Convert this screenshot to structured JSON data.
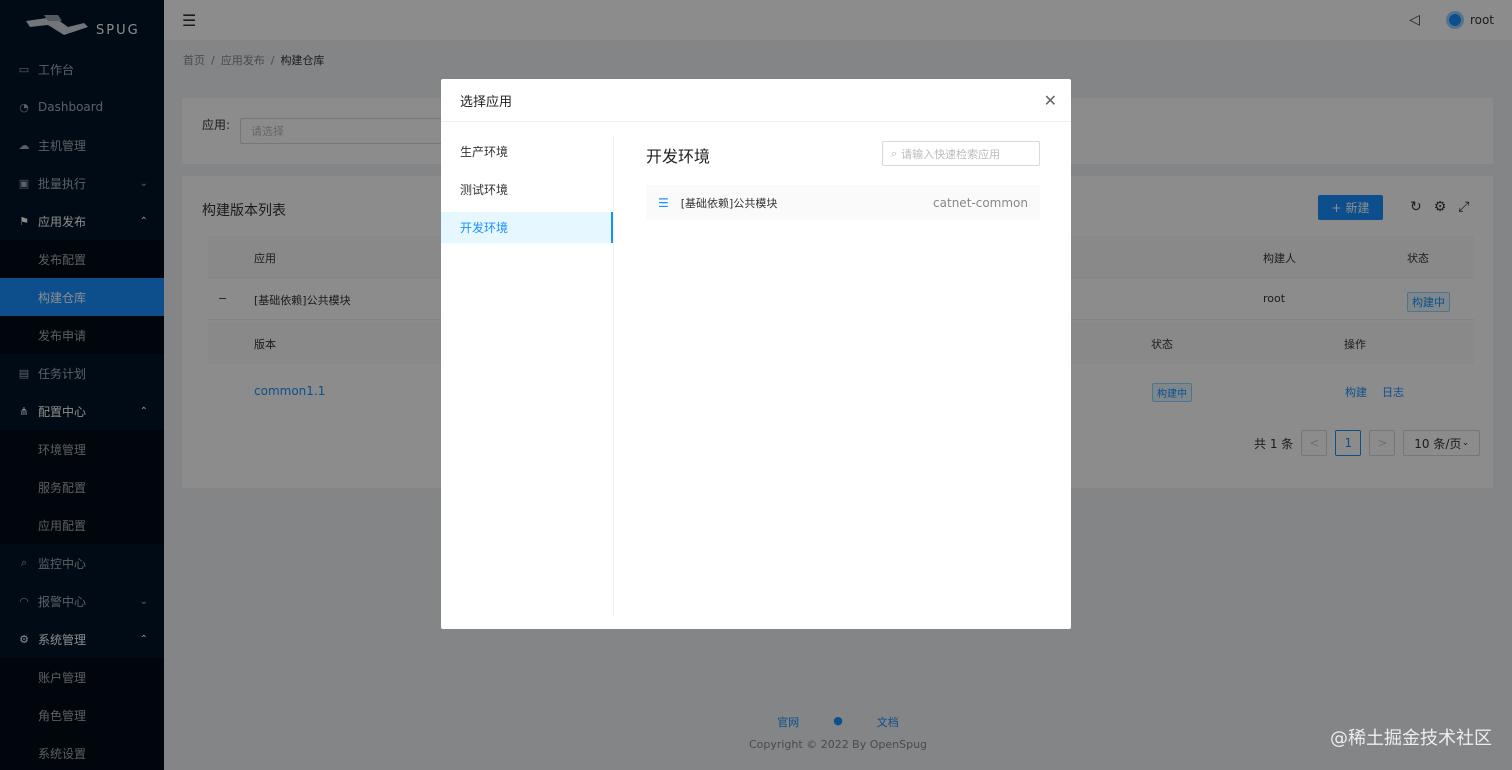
{
  "sidebar": {
    "logo_text": "SPUG",
    "items": [
      {
        "label": "工作台",
        "icon": "monitor-icon"
      },
      {
        "label": "Dashboard",
        "icon": "dashboard-icon"
      },
      {
        "label": "主机管理",
        "icon": "cloud-server-icon"
      },
      {
        "label": "批量执行",
        "icon": "code-icon"
      },
      {
        "label": "应用发布",
        "icon": "flag-icon"
      },
      {
        "label": "发布配置"
      },
      {
        "label": "构建仓库"
      },
      {
        "label": "发布申请"
      },
      {
        "label": "任务计划",
        "icon": "schedule-icon"
      },
      {
        "label": "配置中心",
        "icon": "deployment-icon"
      },
      {
        "label": "环境管理"
      },
      {
        "label": "服务配置"
      },
      {
        "label": "应用配置"
      },
      {
        "label": "监控中心",
        "icon": "search-icon"
      },
      {
        "label": "报警中心",
        "icon": "alert-icon"
      },
      {
        "label": "系统管理",
        "icon": "setting-icon"
      },
      {
        "label": "账户管理"
      },
      {
        "label": "角色管理"
      },
      {
        "label": "系统设置"
      }
    ]
  },
  "header": {
    "user": "root"
  },
  "breadcrumb": [
    "首页",
    "应用发布",
    "构建仓库"
  ],
  "filter": {
    "label": "应用:",
    "placeholder": "请选择"
  },
  "list": {
    "title": "构建版本列表",
    "new_button": "新建",
    "columns": {
      "app": "应用",
      "builder": "构建人",
      "status": "状态"
    },
    "row": {
      "expand": "−",
      "app": "[基础依赖]公共模块",
      "builder": "root",
      "status": "构建中"
    },
    "sub_columns": {
      "version": "版本",
      "status": "状态",
      "action": "操作"
    },
    "sub_row": {
      "version": "common1.1",
      "status": "构建中",
      "build": "构建",
      "log": "日志"
    },
    "pagination": {
      "total": "共 1 条",
      "prev": "<",
      "current": "1",
      "next": ">",
      "size": "10 条/页"
    }
  },
  "footer": {
    "link1": "官网",
    "link3": "文档",
    "copyright": "Copyright © 2022 By OpenSpug"
  },
  "modal": {
    "title": "选择应用",
    "envs": [
      "生产环境",
      "测试环境",
      "开发环境"
    ],
    "active_env_title": "开发环境",
    "search_placeholder": "请输入快速检索应用",
    "app": {
      "name": "[基础依赖]公共模块",
      "key": "catnet-common"
    }
  },
  "watermark": "@稀土掘金技术社区"
}
